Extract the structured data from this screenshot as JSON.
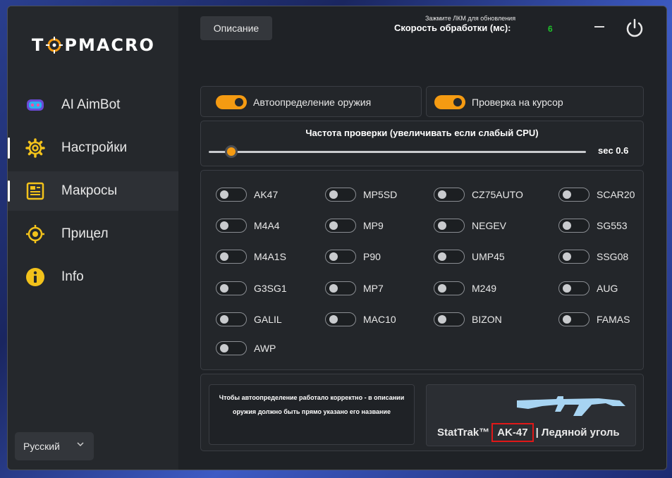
{
  "sidebar": {
    "logo": "TOPMACRO",
    "items": [
      {
        "label": "AI AimBot",
        "icon": "robot-icon"
      },
      {
        "label": "Настройки",
        "icon": "gear-icon"
      },
      {
        "label": "Макросы",
        "icon": "document-icon"
      },
      {
        "label": "Прицел",
        "icon": "crosshair-icon"
      },
      {
        "label": "Info",
        "icon": "info-icon"
      }
    ],
    "language": "Русский"
  },
  "header": {
    "description_button": "Описание",
    "hint": "Зажмите ЛКМ для обновления",
    "speed_label": "Скорость обработки (мс):",
    "speed_value": "6"
  },
  "toggles": {
    "auto_detect": {
      "label": "Автоопределение оружия",
      "on": true
    },
    "cursor_check": {
      "label": "Проверка на курсор",
      "on": true
    }
  },
  "frequency": {
    "title": "Частота проверки (увеличивать если слабый CPU)",
    "value_label": "sec 0.6",
    "fraction": 0.06
  },
  "weapons": [
    [
      "AK47",
      "MP5SD",
      "CZ75AUTO",
      "SCAR20"
    ],
    [
      "M4A4",
      "MP9",
      "NEGEV",
      "SG553"
    ],
    [
      "M4A1S",
      "P90",
      "UMP45",
      "SSG08"
    ],
    [
      "G3SG1",
      "MP7",
      "M249",
      "AUG"
    ],
    [
      "GALIL",
      "MAC10",
      "BIZON",
      "FAMAS"
    ],
    [
      "AWP"
    ]
  ],
  "note": "Чтобы автоопределение работало корректно - в описании оружия должно быть прямо указано его название",
  "preview": {
    "prefix": "StatTrak™",
    "highlight": "AK-47",
    "suffix": "| Ледяной уголь"
  },
  "colors": {
    "accent": "#f59b12",
    "speed_value": "#1fc22a",
    "highlight_border": "#e01818"
  }
}
